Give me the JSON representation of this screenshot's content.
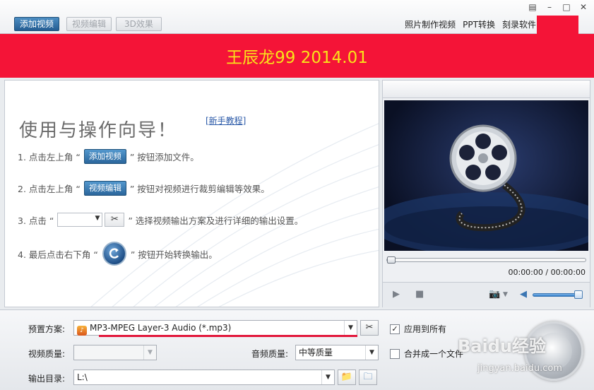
{
  "toolbar": {
    "add_video": "添加视频",
    "video_edit": "视频编辑",
    "effect_3d": "3D效果",
    "links": [
      "照片制作视频",
      "PPT转换",
      "刻录软件"
    ],
    "window_controls": [
      "▤",
      "–",
      "□",
      "✕"
    ]
  },
  "banner": {
    "title": "王辰龙99 2014.01"
  },
  "guide": {
    "title": "使用与操作向导！",
    "help_link": "[新手教程]",
    "steps": [
      {
        "prefix": "1. 点击左上角 “",
        "button": "添加视频",
        "suffix": "” 按钮添加文件。"
      },
      {
        "prefix": "2. 点击左上角 “",
        "button": "视频编辑",
        "suffix": "” 按钮对视频进行裁剪编辑等效果。"
      },
      {
        "prefix": "3. 点击 “",
        "suffix": "” 选择视频输出方案及进行详细的输出设置。"
      },
      {
        "prefix": "4. 最后点击右下角 “",
        "suffix": "” 按钮开始转换输出。"
      }
    ]
  },
  "player": {
    "time": "00:00:00 / 00:00:00",
    "volume_fraction": 1.0
  },
  "settings": {
    "preset_label": "预置方案:",
    "preset_value": "MP3-MPEG Layer-3 Audio (*.mp3)",
    "apply_all": "应用到所有",
    "video_quality_label": "视频质量:",
    "video_quality_value": "",
    "audio_quality_label": "音频质量:",
    "audio_quality_value": "中等质量",
    "merge_label": "合并成一个文件",
    "output_label": "输出目录:",
    "output_value": "L:\\"
  },
  "watermark": {
    "text": "Baidu经验",
    "sub": "jingyan.baidu.com"
  },
  "colors": {
    "banner": "#f41437",
    "title": "#f9e21a",
    "button": "#2b669c"
  }
}
